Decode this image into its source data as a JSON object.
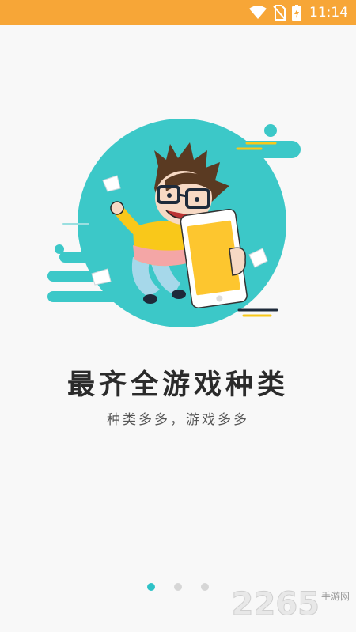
{
  "status_bar": {
    "time": "11:14",
    "icons": [
      "wifi-icon",
      "no-sim-icon",
      "battery-charging-icon"
    ],
    "background": "#f7a637"
  },
  "illustration": {
    "subject": "cartoon-boy-with-phone",
    "accent_color": "#3cc8c8",
    "phone_color": "#fdc62f",
    "shirt_color": "#f9c81a"
  },
  "onboarding": {
    "title": "最齐全游戏种类",
    "subtitle": "种类多多，游戏多多"
  },
  "pager": {
    "total_pages": 3,
    "active_page": 1,
    "active_color": "#2ec2c7",
    "inactive_color": "#d6d6d6"
  },
  "watermark": {
    "number": "2265",
    "tag": "手游网"
  }
}
